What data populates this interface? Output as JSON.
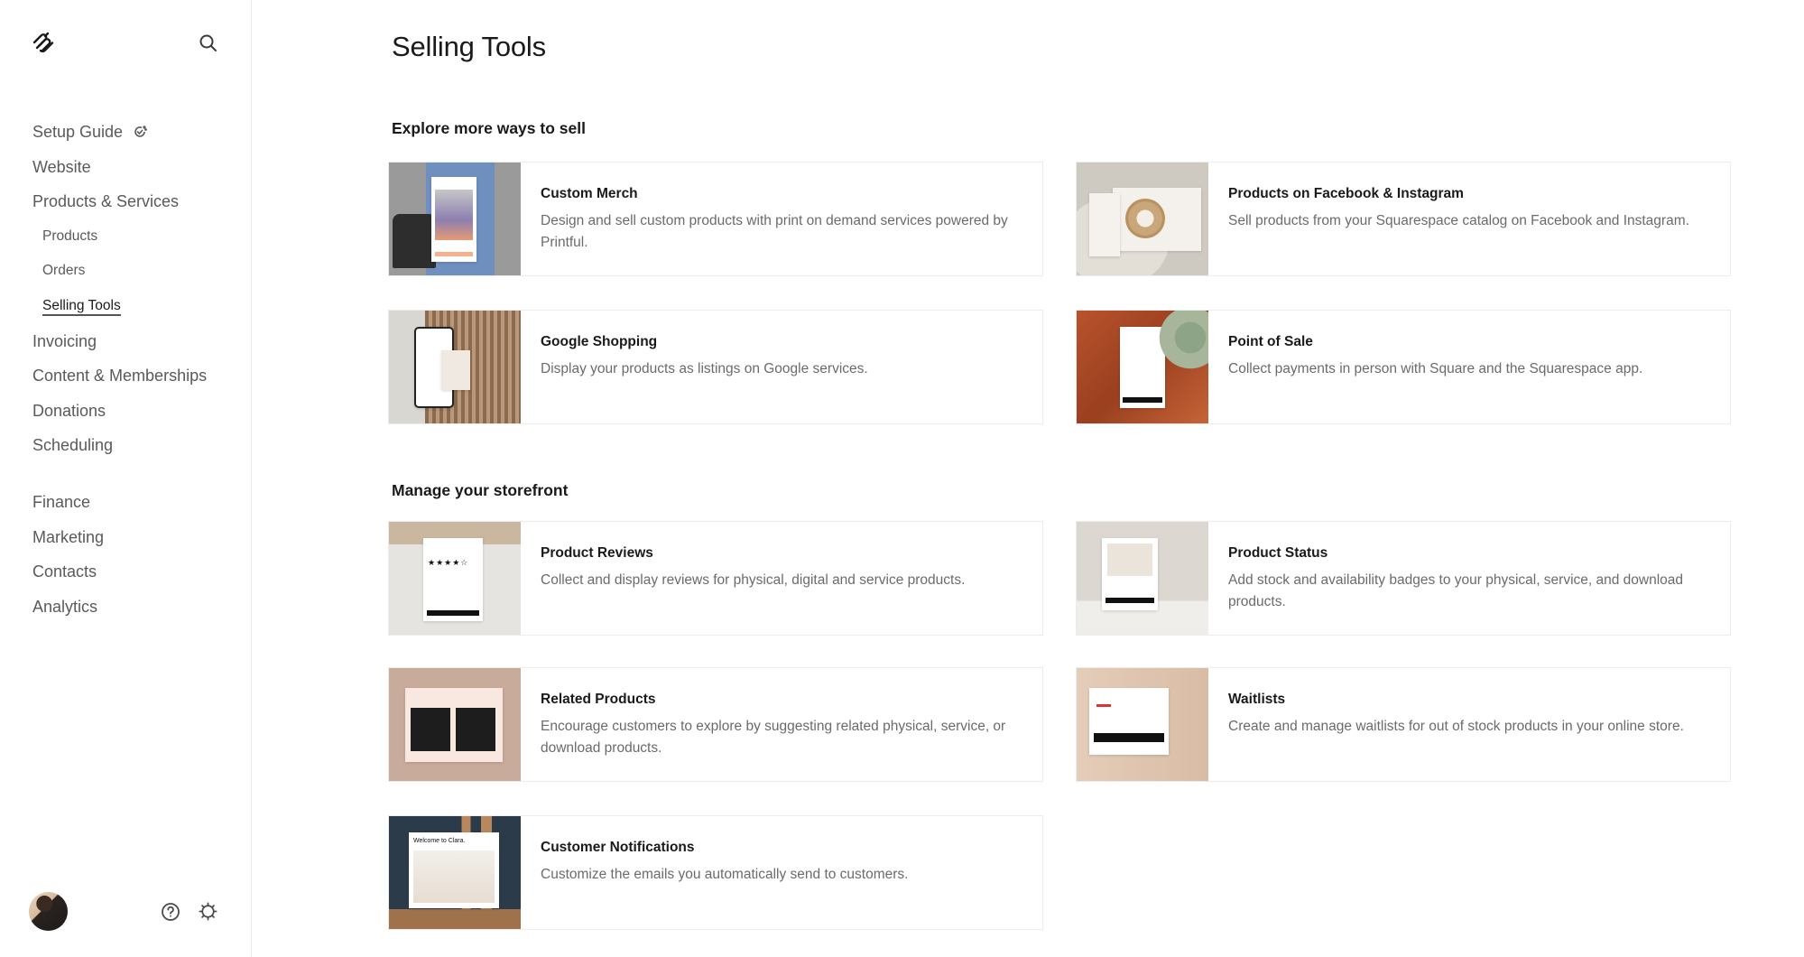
{
  "sidebar": {
    "logo": "squarespace-logo",
    "search_icon": "search-icon",
    "nav": [
      {
        "label": "Setup Guide",
        "icon": "setup-guide-check-icon",
        "level": 1
      },
      {
        "label": "Website",
        "level": 1
      },
      {
        "label": "Products & Services",
        "level": 1
      },
      {
        "label": "Products",
        "level": 2
      },
      {
        "label": "Orders",
        "level": 2
      },
      {
        "label": "Selling Tools",
        "level": 2,
        "active": true
      },
      {
        "label": "Invoicing",
        "level": 1
      },
      {
        "label": "Content & Memberships",
        "level": 1
      },
      {
        "label": "Donations",
        "level": 1
      },
      {
        "label": "Scheduling",
        "level": 1
      },
      {
        "label": "Finance",
        "level": 1
      },
      {
        "label": "Marketing",
        "level": 1
      },
      {
        "label": "Contacts",
        "level": 1
      },
      {
        "label": "Analytics",
        "level": 1
      }
    ],
    "footer": {
      "avatar": "user-avatar",
      "help_icon": "help-icon",
      "settings_icon": "gear-icon"
    }
  },
  "main": {
    "title": "Selling Tools",
    "sections": [
      {
        "heading": "Explore more ways to sell",
        "cards": [
          {
            "title": "Custom Merch",
            "description": "Design and sell custom products with print on demand services powered by Printful."
          },
          {
            "title": "Products on Facebook & Instagram",
            "description": "Sell products from your Squarespace catalog on Facebook and Instagram."
          },
          {
            "title": "Google Shopping",
            "description": "Display your products as listings on Google services."
          },
          {
            "title": "Point of Sale",
            "description": "Collect payments in person with Square and the Squarespace app."
          }
        ]
      },
      {
        "heading": "Manage your storefront",
        "cards": [
          {
            "title": "Product Reviews",
            "description": "Collect and display reviews for physical, digital and service products."
          },
          {
            "title": "Product Status",
            "description": "Add stock and availability badges to your physical, service, and download products."
          },
          {
            "title": "Related Products",
            "description": "Encourage customers to explore by suggesting related physical, service, or download products."
          },
          {
            "title": "Waitlists",
            "description": "Create and manage waitlists for out of stock products in your online store."
          },
          {
            "title": "Customer Notifications",
            "description": "Customize the emails you automatically send to customers."
          }
        ]
      }
    ]
  }
}
